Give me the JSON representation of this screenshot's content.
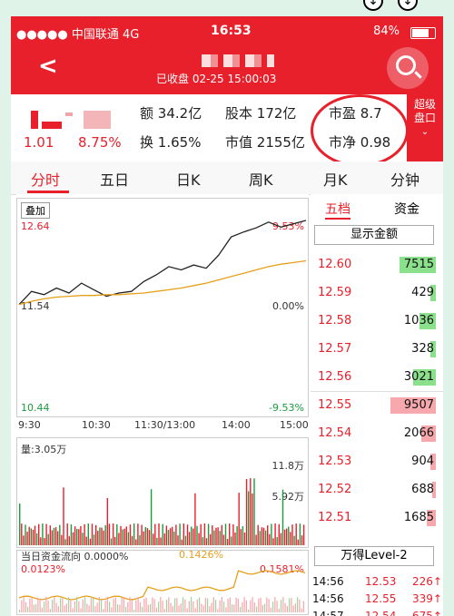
{
  "status": {
    "carrier": "●●●●● 中国联通  4G",
    "time": "16:53",
    "battery": "84%",
    "battery_level": 0.84
  },
  "header": {
    "subtitle": "已收盘 02-25 15:00:03"
  },
  "quote": {
    "change": "1.01",
    "pct": "8.75%",
    "items": [
      {
        "k": "额",
        "v": "34.2亿"
      },
      {
        "k": "股本",
        "v": "172亿"
      },
      {
        "k": "市盈",
        "v": "8.7"
      },
      {
        "k": "换",
        "v": "1.65%"
      },
      {
        "k": "市值",
        "v": "2155亿"
      },
      {
        "k": "市净",
        "v": "0.98"
      }
    ],
    "super": [
      "超级",
      "盘口"
    ]
  },
  "tabs": [
    "分时",
    "五日",
    "日K",
    "周K",
    "月K",
    "分钟"
  ],
  "chart": {
    "overlay": "叠加",
    "price_top": "12.64",
    "price_mid": "11.54",
    "price_bot": "10.44",
    "pct_top": "9.53%",
    "pct_mid": "0.00%",
    "pct_bot": "-9.53%",
    "times": [
      "9:30",
      "10:30",
      "11:30/13:00",
      "14:00",
      "15:00"
    ],
    "vol_label": "量:3.05万",
    "vol_top": "11.8万",
    "vol_mid": "5.92万",
    "flow_label": "当日资金流向 0.0000%",
    "flow_val": "0.1426%",
    "flow_left": "0.0123%",
    "flow_right": "0.1581%"
  },
  "chart_data": {
    "type": "line",
    "x_ticks": [
      "9:30",
      "10:30",
      "11:30/13:00",
      "14:00",
      "15:00"
    ],
    "ylim": [
      10.44,
      12.64
    ],
    "series": [
      {
        "values": [
          11.62,
          11.78,
          11.74,
          11.82,
          11.76,
          11.88,
          11.8,
          11.72,
          11.76,
          11.78,
          11.9,
          11.98,
          12.08,
          12.04,
          12.1,
          12.06,
          12.22,
          12.44,
          12.5,
          12.55,
          12.62,
          12.56,
          12.6,
          12.64
        ]
      },
      {
        "values": [
          11.62,
          11.66,
          11.69,
          11.71,
          11.72,
          11.73,
          11.73,
          11.74,
          11.74,
          11.75,
          11.76,
          11.78,
          11.8,
          11.82,
          11.85,
          11.88,
          11.92,
          11.96,
          12.0,
          12.04,
          12.08,
          12.11,
          12.13,
          12.15
        ]
      }
    ]
  },
  "book": {
    "tab1": "五档",
    "tab2": "资金",
    "show": "显示金额",
    "rows": [
      {
        "p": "12.60",
        "v": "7515",
        "c": "#8be08b"
      },
      {
        "p": "12.59",
        "v": "429",
        "c": "#8be08b"
      },
      {
        "p": "12.58",
        "v": "1036",
        "c": "#8be08b"
      },
      {
        "p": "12.57",
        "v": "328",
        "c": "#8be08b"
      },
      {
        "p": "12.56",
        "v": "3021",
        "c": "#8be08b"
      },
      {
        "p": "12.55",
        "v": "9507",
        "c": "#f7a8ad"
      },
      {
        "p": "12.54",
        "v": "2066",
        "c": "#f7a8ad"
      },
      {
        "p": "12.53",
        "v": "904",
        "c": "#f7a8ad"
      },
      {
        "p": "12.52",
        "v": "688",
        "c": "#f7a8ad"
      },
      {
        "p": "12.51",
        "v": "1685",
        "c": "#f7a8ad"
      }
    ],
    "rows_fill": [
      0.4,
      0.06,
      0.18,
      0.06,
      0.25,
      0.5,
      0.16,
      0.06,
      0.04,
      0.1
    ],
    "level": "万得Level-2",
    "trades": [
      {
        "t": "14:56",
        "p": "12.53",
        "v": "226↑"
      },
      {
        "t": "14:56",
        "p": "12.55",
        "v": "339↑"
      },
      {
        "t": "14:57",
        "p": "12.54",
        "v": "675↑"
      }
    ]
  }
}
